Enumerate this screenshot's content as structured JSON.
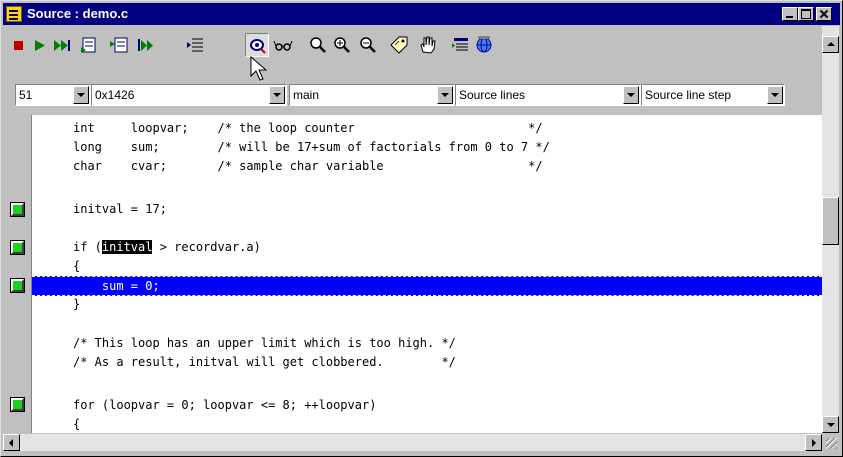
{
  "window": {
    "title": "Source : demo.c",
    "accent": "#000080"
  },
  "toolbar": {
    "buttons": [
      {
        "name": "stop",
        "icon": "stop-icon"
      },
      {
        "name": "run",
        "icon": "play-icon"
      },
      {
        "name": "run-to-end",
        "icon": "fast-forward-icon"
      },
      {
        "name": "step-into",
        "icon": "step-into-icon"
      },
      {
        "name": "step-over",
        "icon": "step-over-icon"
      },
      {
        "name": "step-out",
        "icon": "step-out-icon"
      },
      {
        "name": "go-to-line",
        "icon": "list-arrow-icon"
      },
      {
        "name": "watch-point",
        "icon": "eye-pointer-icon",
        "pressed": true
      },
      {
        "name": "glasses",
        "icon": "glasses-icon"
      },
      {
        "name": "zoom",
        "icon": "magnifier-icon"
      },
      {
        "name": "zoom-in",
        "icon": "magnifier-plus-icon"
      },
      {
        "name": "zoom-out",
        "icon": "magnifier-minus-icon"
      },
      {
        "name": "tag",
        "icon": "tag-icon"
      },
      {
        "name": "hand",
        "icon": "hand-icon"
      },
      {
        "name": "list",
        "icon": "list-icon"
      },
      {
        "name": "globe",
        "icon": "globe-icon"
      }
    ]
  },
  "combos": {
    "line": "51",
    "address": "0x1426",
    "function": "main",
    "view_mode": "Source lines",
    "step_mode": "Source line step"
  },
  "code": {
    "lines": [
      {
        "text": "int     loopvar;    /* the loop counter                        */",
        "bp": false
      },
      {
        "text": "long    sum;        /* will be 17+sum of factorials from 0 to 7 */",
        "bp": false
      },
      {
        "text": "char    cvar;       /* sample char variable                    */",
        "bp": false
      },
      {
        "text": "",
        "bp": false
      },
      {
        "text": "initval = 17;",
        "bp": true
      },
      {
        "text": "",
        "bp": false
      },
      {
        "pre": "if (",
        "hl": "initval",
        "post": " > recordvar.a)",
        "bp": true
      },
      {
        "text": "{",
        "bp": false
      },
      {
        "text": "    sum = 0;",
        "bp": true,
        "current": true
      },
      {
        "text": "}",
        "bp": false
      },
      {
        "text": "",
        "bp": false
      },
      {
        "text": "/* This loop has an upper limit which is too high. */",
        "bp": false
      },
      {
        "text": "/* As a result, initval will get clobbered.        */",
        "bp": false
      },
      {
        "text": "",
        "bp": false
      },
      {
        "text": "for (loopvar = 0; loopvar <= 8; ++loopvar)",
        "bp": true
      },
      {
        "text": "{",
        "bp": false
      }
    ],
    "current_line_color": "#0000ff",
    "breakpoint_color": "#20d020"
  }
}
